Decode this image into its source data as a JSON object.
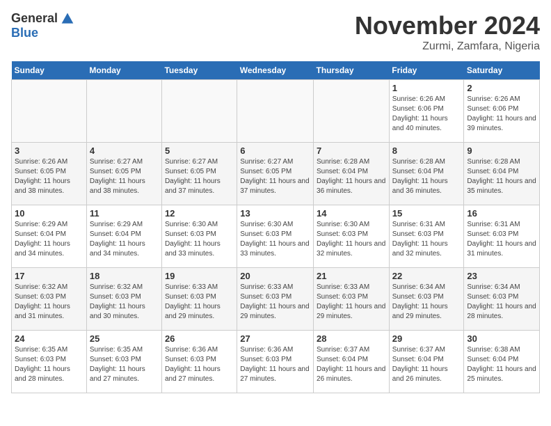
{
  "logo": {
    "general": "General",
    "blue": "Blue"
  },
  "header": {
    "title": "November 2024",
    "subtitle": "Zurmi, Zamfara, Nigeria"
  },
  "days_of_week": [
    "Sunday",
    "Monday",
    "Tuesday",
    "Wednesday",
    "Thursday",
    "Friday",
    "Saturday"
  ],
  "weeks": [
    [
      {
        "day": "",
        "info": ""
      },
      {
        "day": "",
        "info": ""
      },
      {
        "day": "",
        "info": ""
      },
      {
        "day": "",
        "info": ""
      },
      {
        "day": "",
        "info": ""
      },
      {
        "day": "1",
        "info": "Sunrise: 6:26 AM\nSunset: 6:06 PM\nDaylight: 11 hours and 40 minutes."
      },
      {
        "day": "2",
        "info": "Sunrise: 6:26 AM\nSunset: 6:06 PM\nDaylight: 11 hours and 39 minutes."
      }
    ],
    [
      {
        "day": "3",
        "info": "Sunrise: 6:26 AM\nSunset: 6:05 PM\nDaylight: 11 hours and 38 minutes."
      },
      {
        "day": "4",
        "info": "Sunrise: 6:27 AM\nSunset: 6:05 PM\nDaylight: 11 hours and 38 minutes."
      },
      {
        "day": "5",
        "info": "Sunrise: 6:27 AM\nSunset: 6:05 PM\nDaylight: 11 hours and 37 minutes."
      },
      {
        "day": "6",
        "info": "Sunrise: 6:27 AM\nSunset: 6:05 PM\nDaylight: 11 hours and 37 minutes."
      },
      {
        "day": "7",
        "info": "Sunrise: 6:28 AM\nSunset: 6:04 PM\nDaylight: 11 hours and 36 minutes."
      },
      {
        "day": "8",
        "info": "Sunrise: 6:28 AM\nSunset: 6:04 PM\nDaylight: 11 hours and 36 minutes."
      },
      {
        "day": "9",
        "info": "Sunrise: 6:28 AM\nSunset: 6:04 PM\nDaylight: 11 hours and 35 minutes."
      }
    ],
    [
      {
        "day": "10",
        "info": "Sunrise: 6:29 AM\nSunset: 6:04 PM\nDaylight: 11 hours and 34 minutes."
      },
      {
        "day": "11",
        "info": "Sunrise: 6:29 AM\nSunset: 6:04 PM\nDaylight: 11 hours and 34 minutes."
      },
      {
        "day": "12",
        "info": "Sunrise: 6:30 AM\nSunset: 6:03 PM\nDaylight: 11 hours and 33 minutes."
      },
      {
        "day": "13",
        "info": "Sunrise: 6:30 AM\nSunset: 6:03 PM\nDaylight: 11 hours and 33 minutes."
      },
      {
        "day": "14",
        "info": "Sunrise: 6:30 AM\nSunset: 6:03 PM\nDaylight: 11 hours and 32 minutes."
      },
      {
        "day": "15",
        "info": "Sunrise: 6:31 AM\nSunset: 6:03 PM\nDaylight: 11 hours and 32 minutes."
      },
      {
        "day": "16",
        "info": "Sunrise: 6:31 AM\nSunset: 6:03 PM\nDaylight: 11 hours and 31 minutes."
      }
    ],
    [
      {
        "day": "17",
        "info": "Sunrise: 6:32 AM\nSunset: 6:03 PM\nDaylight: 11 hours and 31 minutes."
      },
      {
        "day": "18",
        "info": "Sunrise: 6:32 AM\nSunset: 6:03 PM\nDaylight: 11 hours and 30 minutes."
      },
      {
        "day": "19",
        "info": "Sunrise: 6:33 AM\nSunset: 6:03 PM\nDaylight: 11 hours and 29 minutes."
      },
      {
        "day": "20",
        "info": "Sunrise: 6:33 AM\nSunset: 6:03 PM\nDaylight: 11 hours and 29 minutes."
      },
      {
        "day": "21",
        "info": "Sunrise: 6:33 AM\nSunset: 6:03 PM\nDaylight: 11 hours and 29 minutes."
      },
      {
        "day": "22",
        "info": "Sunrise: 6:34 AM\nSunset: 6:03 PM\nDaylight: 11 hours and 29 minutes."
      },
      {
        "day": "23",
        "info": "Sunrise: 6:34 AM\nSunset: 6:03 PM\nDaylight: 11 hours and 28 minutes."
      }
    ],
    [
      {
        "day": "24",
        "info": "Sunrise: 6:35 AM\nSunset: 6:03 PM\nDaylight: 11 hours and 28 minutes."
      },
      {
        "day": "25",
        "info": "Sunrise: 6:35 AM\nSunset: 6:03 PM\nDaylight: 11 hours and 27 minutes."
      },
      {
        "day": "26",
        "info": "Sunrise: 6:36 AM\nSunset: 6:03 PM\nDaylight: 11 hours and 27 minutes."
      },
      {
        "day": "27",
        "info": "Sunrise: 6:36 AM\nSunset: 6:03 PM\nDaylight: 11 hours and 27 minutes."
      },
      {
        "day": "28",
        "info": "Sunrise: 6:37 AM\nSunset: 6:04 PM\nDaylight: 11 hours and 26 minutes."
      },
      {
        "day": "29",
        "info": "Sunrise: 6:37 AM\nSunset: 6:04 PM\nDaylight: 11 hours and 26 minutes."
      },
      {
        "day": "30",
        "info": "Sunrise: 6:38 AM\nSunset: 6:04 PM\nDaylight: 11 hours and 25 minutes."
      }
    ]
  ]
}
